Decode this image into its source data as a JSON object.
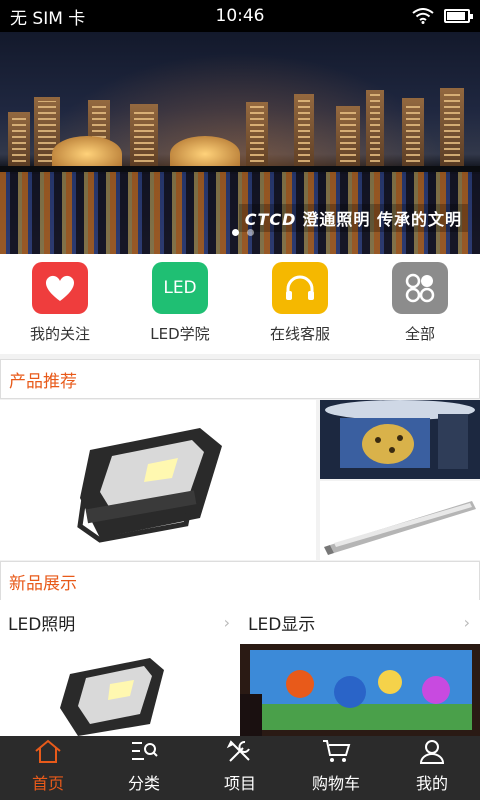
{
  "status_bar": {
    "carrier": "无 SIM 卡",
    "time": "10:46",
    "battery_level": 0.8
  },
  "banner": {
    "caption": "澄通照明 传承的文明",
    "logo_text": "CTCD",
    "slide_index": 1,
    "slide_count": 2
  },
  "quick_menu": [
    {
      "label": "我的关注",
      "icon": "heart-icon",
      "color": "#ef3d3d"
    },
    {
      "label": "LED学院",
      "icon": "led-icon",
      "icon_text": "LED",
      "color": "#1fbf73"
    },
    {
      "label": "在线客服",
      "icon": "headset-icon",
      "color": "#f5b800"
    },
    {
      "label": "全部",
      "icon": "grid-icon",
      "color": "#8c8c8c"
    }
  ],
  "sections": {
    "recommend": "产品推荐",
    "new": "新品展示"
  },
  "categories": [
    {
      "label": "LED照明"
    },
    {
      "label": "LED显示"
    }
  ],
  "tabbar": [
    {
      "label": "首页",
      "icon": "home-icon",
      "active": true
    },
    {
      "label": "分类",
      "icon": "category-search-icon",
      "active": false
    },
    {
      "label": "项目",
      "icon": "tools-icon",
      "active": false
    },
    {
      "label": "购物车",
      "icon": "cart-icon",
      "active": false
    },
    {
      "label": "我的",
      "icon": "user-icon",
      "active": false
    }
  ],
  "colors": {
    "accent": "#e85a1a",
    "tabbar_bg": "#2b2b2b"
  }
}
